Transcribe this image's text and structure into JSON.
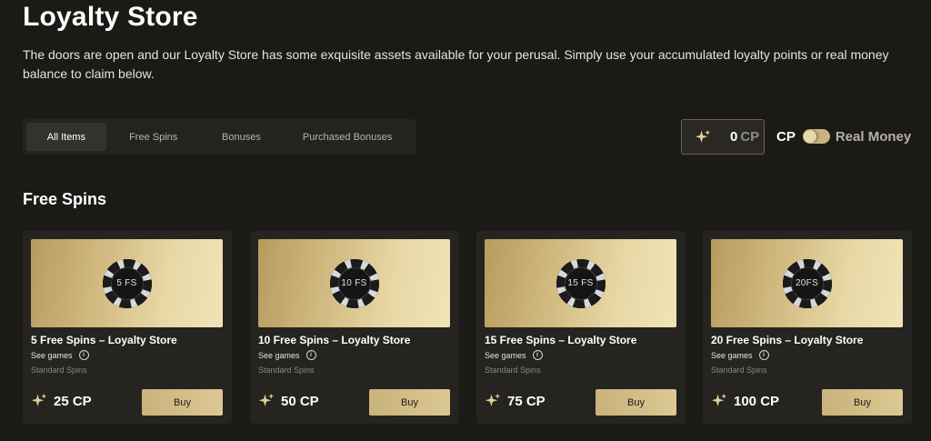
{
  "header": {
    "title": "Loyalty Store",
    "intro": "The doors are open and our Loyalty Store has some exquisite assets available for your perusal. Simply use your accumulated loyalty points or real money balance to claim below."
  },
  "tabs": [
    {
      "label": "All Items",
      "active": true
    },
    {
      "label": "Free Spins",
      "active": false
    },
    {
      "label": "Bonuses",
      "active": false
    },
    {
      "label": "Purchased Bonuses",
      "active": false
    }
  ],
  "balance": {
    "icon": "sparkle-icon",
    "amount": "0",
    "unit": "CP"
  },
  "currency_toggle": {
    "left_label": "CP",
    "right_label": "Real Money",
    "selected": "CP"
  },
  "section": {
    "title": "Free Spins"
  },
  "cards": [
    {
      "chip_label": "5 FS",
      "title": "5 Free Spins – Loyalty Store",
      "see_games": "See games",
      "type": "Standard Spins",
      "price": "25 CP",
      "buy_label": "Buy"
    },
    {
      "chip_label": "10 FS",
      "title": "10 Free Spins – Loyalty Store",
      "see_games": "See games",
      "type": "Standard Spins",
      "price": "50 CP",
      "buy_label": "Buy"
    },
    {
      "chip_label": "15 FS",
      "title": "15 Free Spins – Loyalty Store",
      "see_games": "See games",
      "type": "Standard Spins",
      "price": "75 CP",
      "buy_label": "Buy"
    },
    {
      "chip_label": "20FS",
      "title": "20 Free Spins – Loyalty Store",
      "see_games": "See games",
      "type": "Standard Spins",
      "price": "100 CP",
      "buy_label": "Buy"
    }
  ],
  "colors": {
    "background": "#1b1a17",
    "gold": "#d4bd84",
    "card": "#252420"
  }
}
